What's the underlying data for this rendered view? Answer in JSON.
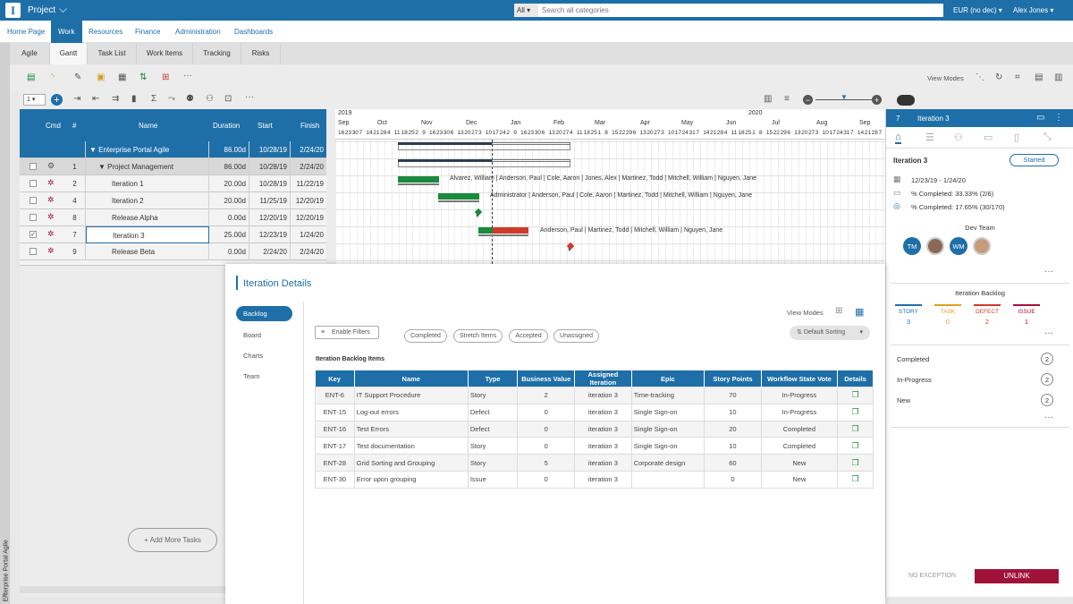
{
  "topbar": {
    "app_title": "Project",
    "search_scope": "All",
    "search_placeholder": "Search all categories",
    "currency": "EUR (no dec)",
    "user": "Alex Jones"
  },
  "nav": {
    "items": [
      "Home Page",
      "Work",
      "Resources",
      "Finance",
      "Administration",
      "Dashboards"
    ]
  },
  "subtabs": [
    "Agile",
    "Gantt",
    "Task List",
    "Work Items",
    "Tracking",
    "Risks"
  ],
  "toolbar": {
    "view_modes": "View Modes",
    "level": "1"
  },
  "grid": {
    "headers": {
      "cmd": "Cmd",
      "num": "#",
      "name": "Name",
      "duration": "Duration",
      "start": "Start",
      "finish": "Finish"
    },
    "rows": [
      {
        "num": "",
        "name": "▼ Enterprise Portal Agile",
        "duration": "86.00d",
        "start": "10/28/19",
        "finish": "2/24/20"
      },
      {
        "num": "1",
        "name": "▼ Project Management",
        "duration": "86.00d",
        "start": "10/28/19",
        "finish": "2/24/20"
      },
      {
        "num": "2",
        "name": "Iteration 1",
        "duration": "20.00d",
        "start": "10/28/19",
        "finish": "11/22/19"
      },
      {
        "num": "4",
        "name": "Iteration 2",
        "duration": "20.00d",
        "start": "11/25/19",
        "finish": "12/20/19"
      },
      {
        "num": "8",
        "name": "Release Alpha",
        "duration": "0.00d",
        "start": "12/20/19",
        "finish": "12/20/19"
      },
      {
        "num": "7",
        "name": "Iteration 3",
        "duration": "25.00d",
        "start": "12/23/19",
        "finish": "1/24/20"
      },
      {
        "num": "9",
        "name": "Release Beta",
        "duration": "0.00d",
        "start": "2/24/20",
        "finish": "2/24/20"
      }
    ],
    "add_more": "+ Add More Tasks",
    "side_label": "Enterprise Portal Agile"
  },
  "gantt": {
    "years": [
      "2019",
      "2020"
    ],
    "months": [
      "Sep",
      "Oct",
      "Nov",
      "Dec",
      "Jan",
      "Feb",
      "Mar",
      "Apr",
      "May",
      "Jun",
      "Jul",
      "Aug",
      "Sep"
    ],
    "days": [
      "16",
      "23",
      "30",
      "7",
      "14",
      "21",
      "28",
      "4",
      "11",
      "18",
      "25",
      "2",
      "9",
      "16",
      "23",
      "30",
      "6",
      "13",
      "20",
      "27",
      "3",
      "10",
      "17",
      "24",
      "2",
      "9",
      "16",
      "23",
      "30",
      "6",
      "13",
      "20",
      "27",
      "4",
      "11",
      "18",
      "25",
      "1",
      "8",
      "15",
      "22",
      "29",
      "6",
      "13",
      "20",
      "27",
      "3",
      "10",
      "17",
      "24",
      "31",
      "7",
      "14",
      "21",
      "28",
      "4",
      "11",
      "18",
      "25",
      "1",
      "8",
      "15",
      "22",
      "29",
      "6",
      "13",
      "20",
      "27",
      "3",
      "10",
      "17",
      "24",
      "31",
      "7",
      "14",
      "21",
      "28",
      "7",
      "14"
    ],
    "labels": {
      "iter1": "Alvarez, William | Anderson, Paul | Cole, Aaron | Jones, Alex | Martinez, Todd | Mitchell, William | Nguyen, Jane",
      "iter2": "Administrator | Anderson, Paul | Cole, Aaron | Martinez, Todd | Mitchell, William | Nguyen, Jane",
      "iter3": "Anderson, Paul | Martinez, Todd | Mitchell, William | Nguyen, Jane"
    },
    "colors": {
      "done": "#1a8a3c",
      "late": "#d13a2a",
      "summary": "#2c3e50"
    }
  },
  "right_panel": {
    "num": "7",
    "title": "Iteration 3",
    "name": "Iteration 3",
    "status": "Started",
    "dates": "12/23/19 - 1/24/20",
    "pct1": "% Completed: 33.33% (2/6)",
    "pct2": "% Completed: 17.65% (30/170)",
    "dev_team_label": "Dev Team",
    "team": [
      "TM",
      "",
      "WM",
      ""
    ],
    "backlog_label": "Iteration Backlog",
    "backlog": [
      {
        "label": "STORY",
        "count": "3",
        "color": "#1e6fa8"
      },
      {
        "label": "TASK",
        "count": "0",
        "color": "#e0a020"
      },
      {
        "label": "DEFECT",
        "count": "2",
        "color": "#d13a2a"
      },
      {
        "label": "ISSUE",
        "count": "1",
        "color": "#a0123a"
      }
    ],
    "states": [
      {
        "label": "Completed",
        "count": "2"
      },
      {
        "label": "In-Progress",
        "count": "2"
      },
      {
        "label": "New",
        "count": "2"
      }
    ],
    "no_exception": "NO EXCEPTION",
    "unlink": "UNLINK"
  },
  "modal": {
    "title": "Iteration Details",
    "tabs": [
      "Backlog",
      "Board",
      "Charts",
      "Team"
    ],
    "view_modes": "View Modes",
    "enable_filters": "Enable Filters",
    "pills": [
      "Completed",
      "Stretch Items",
      "Accepted",
      "Unassigned"
    ],
    "sorting": "Default Sorting",
    "table_title": "Iteration Backlog Items",
    "columns": [
      "Key",
      "Name",
      "Type",
      "Business Value",
      "Assigned Iteration",
      "Epic",
      "Story Points",
      "Workflow State Vote",
      "Details"
    ],
    "rows": [
      {
        "key": "ENT-6",
        "name": "IT Support Procedure",
        "type": "Story",
        "bv": "2",
        "iter": "iteration 3",
        "epic": "Time-tracking",
        "sp": "70",
        "state": "In-Progress"
      },
      {
        "key": "ENT-15",
        "name": "Log-out errors",
        "type": "Defect",
        "bv": "0",
        "iter": "iteration 3",
        "epic": "Single Sign-on",
        "sp": "10",
        "state": "In-Progress"
      },
      {
        "key": "ENT-16",
        "name": "Test Errors",
        "type": "Defect",
        "bv": "0",
        "iter": "iteration 3",
        "epic": "Single Sign-on",
        "sp": "20",
        "state": "Completed"
      },
      {
        "key": "ENT-17",
        "name": "Test documentation",
        "type": "Story",
        "bv": "0",
        "iter": "iteration 3",
        "epic": "Single Sign-on",
        "sp": "10",
        "state": "Completed"
      },
      {
        "key": "ENT-28",
        "name": "Grid Sorting and Grouping",
        "type": "Story",
        "bv": "5",
        "iter": "iteration 3",
        "epic": "Corporate design",
        "sp": "60",
        "state": "New"
      },
      {
        "key": "ENT-30",
        "name": "Error upon grouping",
        "type": "Issue",
        "bv": "0",
        "iter": "iteration 3",
        "epic": "",
        "sp": "0",
        "state": "New"
      }
    ]
  }
}
